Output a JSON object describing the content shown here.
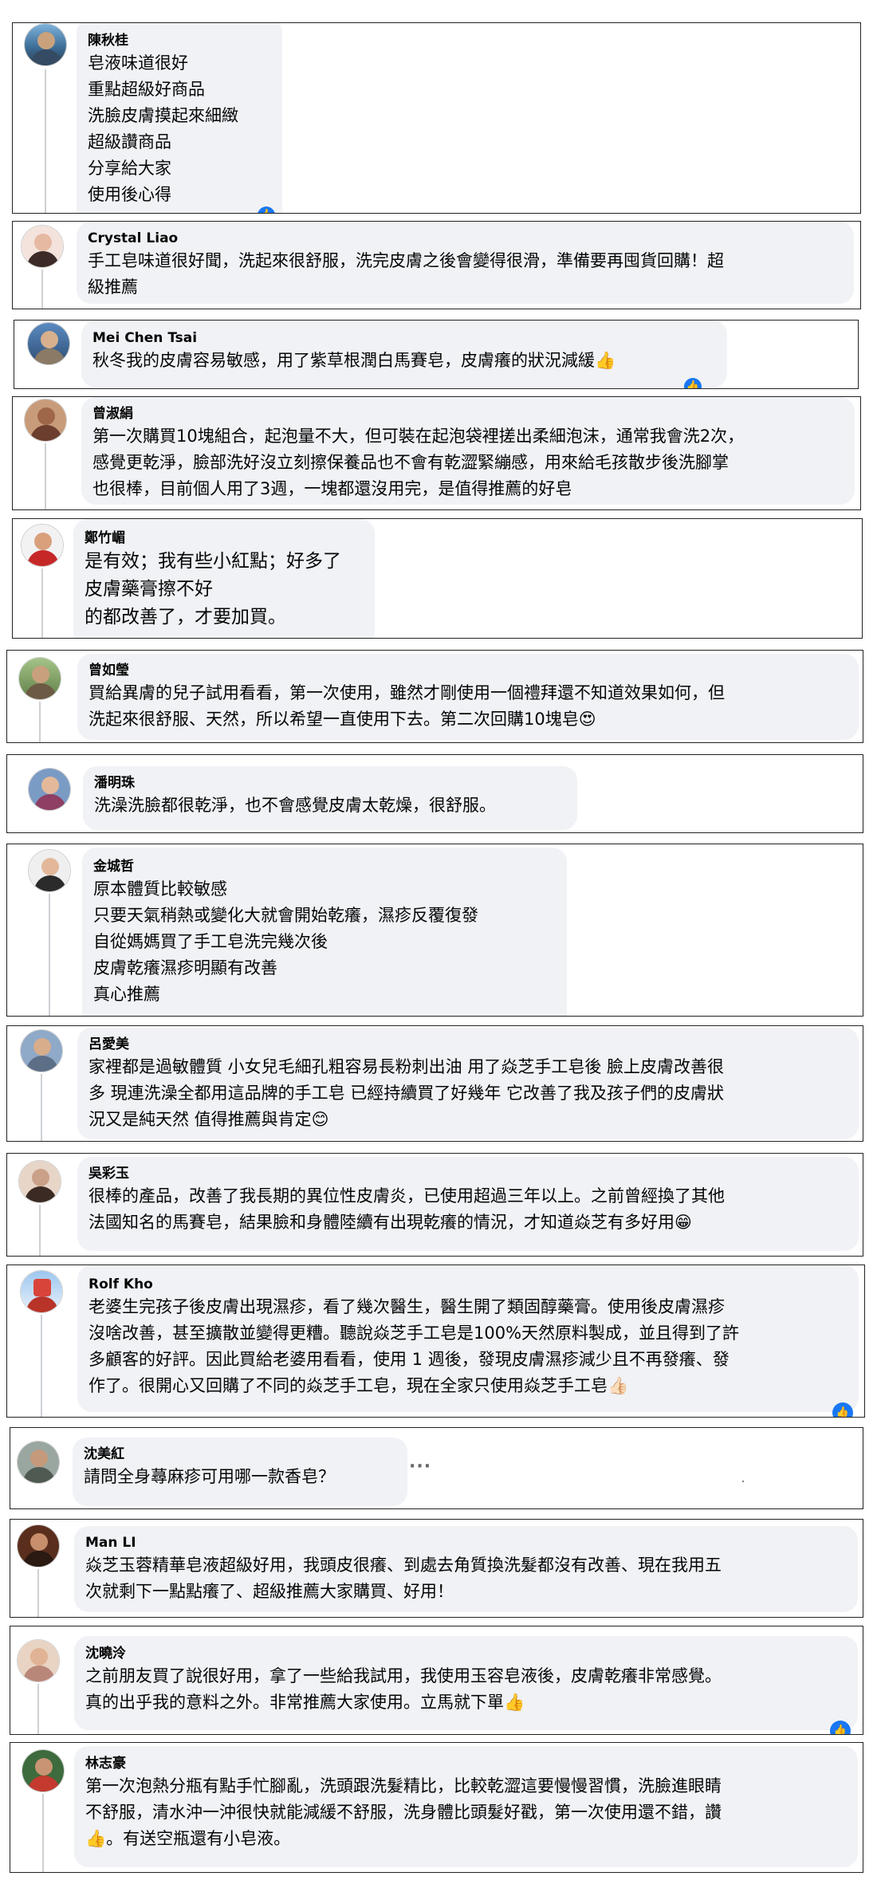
{
  "comments": [
    {
      "name": "陳秋桂",
      "lines": [
        "皂液味道很好",
        "重點超級好商品",
        "洗臉皮膚摸起來細緻",
        "超級讚商品",
        "分享給大家",
        "使用後心得"
      ]
    },
    {
      "name": "Crystal Liao",
      "lines": [
        "手工皂味道很好聞，洗起來很舒服，洗完皮膚之後會變得很滑，準備要再囤貨回購！超",
        "級推薦"
      ]
    },
    {
      "name": "Mei Chen Tsai",
      "lines": [
        "秋冬我的皮膚容易敏感，用了紫草根潤白馬賽皂，皮膚癢的狀況減緩👍"
      ]
    },
    {
      "name": "曾淑絹",
      "lines": [
        "第一次購買10塊組合，起泡量不大，但可裝在起泡袋裡搓出柔細泡沫，通常我會洗2次，",
        "感覺更乾淨，臉部洗好沒立刻擦保養品也不會有乾澀緊繃感，用來給毛孩散步後洗腳掌",
        "也很棒，目前個人用了3週，一塊都還沒用完，是值得推薦的好皂"
      ]
    },
    {
      "name": "鄭竹嵋",
      "lines": [
        "是有效；我有些小紅點；好多了",
        "皮膚藥膏擦不好",
        "的都改善了，才要加買。"
      ]
    },
    {
      "name": "曾如瑩",
      "lines": [
        "買給異膚的兒子試用看看，第一次使用，雖然才剛使用一個禮拜還不知道效果如何，但",
        "洗起來很舒服、天然，所以希望一直使用下去。第二次回購10塊皂😍"
      ]
    },
    {
      "name": "潘明珠",
      "lines": [
        "洗澡洗臉都很乾淨，也不會感覺皮膚太乾燥，很舒服。"
      ]
    },
    {
      "name": "金城哲",
      "lines": [
        "原本體質比較敏感",
        "只要天氣稍熱或變化大就會開始乾癢，濕疹反覆復發",
        "自從媽媽買了手工皂洗完幾次後",
        "皮膚乾癢濕疹明顯有改善",
        "真心推薦"
      ]
    },
    {
      "name": "呂愛美",
      "lines": [
        "家裡都是過敏體質 小女兒毛細孔粗容易長粉刺出油 用了焱芝手工皂後 臉上皮膚改善很",
        "多 現連洗澡全都用這品牌的手工皂 已經持續買了好幾年 它改善了我及孩子們的皮膚狀",
        "況又是純天然 值得推薦與肯定😊"
      ]
    },
    {
      "name": "吳彩玉",
      "lines": [
        "很棒的產品，改善了我長期的異位性皮膚炎，已使用超過三年以上。之前曾經換了其他",
        "法國知名的馬賽皂，結果臉和身體陸續有出現乾癢的情況，才知道焱芝有多好用😁"
      ]
    },
    {
      "name": "Rolf Kho",
      "lines": [
        "老婆生完孩子後皮膚出現濕疹，看了幾次醫生，醫生開了類固醇藥膏。使用後皮膚濕疹",
        "沒啥改善，甚至擴散並變得更糟。聽說焱芝手工皂是100%天然原料製成，並且得到了許",
        "多顧客的好評。因此買給老婆用看看，使用 1 週後，發現皮膚濕疹減少且不再發癢、發",
        "作了。很開心又回購了不同的焱芝手工皂，現在全家只使用焱芝手工皂👍🏻"
      ]
    },
    {
      "name": "沈美紅",
      "lines": [
        "請問全身蕁麻疹可用哪一款香皂？"
      ],
      "extra": "···"
    },
    {
      "name": "Man LI",
      "lines": [
        "焱芝玉蓉精華皂液超級好用，我頭皮很癢、到處去角質換洗髮都沒有改善、現在我用五",
        "次就剩下一點點癢了、超級推薦大家購買、好用！"
      ]
    },
    {
      "name": "沈曉泠",
      "lines": [
        "之前朋友買了說很好用，拿了一些給我試用，我使用玉容皂液後，皮膚乾癢非常感覺。",
        "真的出乎我的意料之外。非常推薦大家使用。立馬就下單👍"
      ]
    },
    {
      "name": "林志豪",
      "lines": [
        "第一次泡熱分瓶有點手忙腳亂，洗頭跟洗髮精比，比較乾澀這要慢慢習慣，洗臉進眼睛",
        "不舒服，清水沖一沖很快就能減緩不舒服，洗身體比頭髮好戳，第一次使用還不錯，讚",
        "👍。有送空瓶還有小皂液。"
      ]
    }
  ],
  "colors": {
    "bubble": "#f0f2f5",
    "border": "#222222",
    "reaction": "#1877f2",
    "text": "#050505"
  },
  "icons": [
    "like-reaction-icon",
    "more-dots-icon",
    "avatar"
  ]
}
